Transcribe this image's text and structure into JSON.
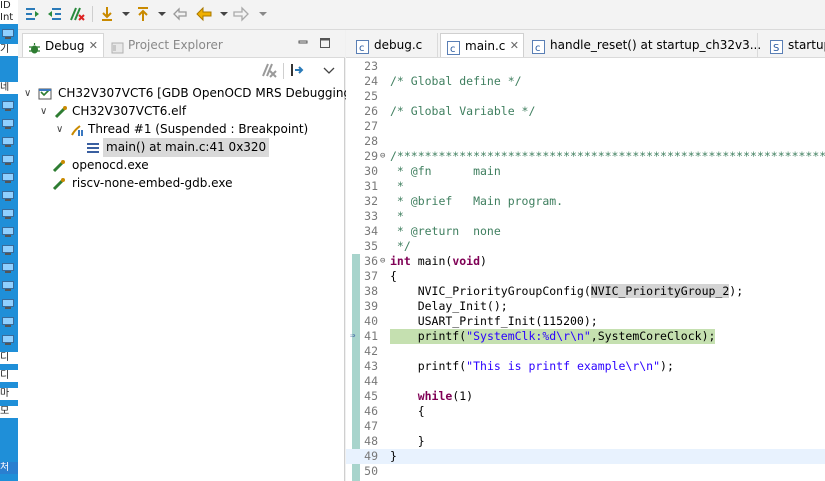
{
  "desktop": {
    "labels": [
      "ID",
      "Int",
      "기",
      "네",
      "디",
      "디",
      "마",
      "모",
      "처"
    ]
  },
  "left_panel": {
    "tabs": [
      {
        "label": "Debug",
        "close": "✕",
        "active": true
      },
      {
        "label": "Project Explorer",
        "active": false
      }
    ],
    "tree": [
      {
        "label": "CH32V307VCT6 [GDB OpenOCD MRS Debugging]",
        "level": 0,
        "arrow": "∨"
      },
      {
        "label": "CH32V307VCT6.elf",
        "level": 1,
        "arrow": "∨"
      },
      {
        "label": "Thread #1 (Suspended : Breakpoint)",
        "level": 2,
        "arrow": "∨"
      },
      {
        "label": "main() at main.c:41 0x320",
        "level": 3,
        "arrow": ""
      },
      {
        "label": "openocd.exe",
        "level": 1,
        "arrow": ""
      },
      {
        "label": "riscv-none-embed-gdb.exe",
        "level": 1,
        "arrow": ""
      }
    ]
  },
  "editor": {
    "tabs": [
      {
        "label": "debug.c",
        "active": false
      },
      {
        "label": "main.c",
        "close": "✕",
        "active": true
      },
      {
        "label": "handle_reset() at startup_ch32v3...",
        "active": false
      },
      {
        "label": "startup",
        "active": false
      }
    ],
    "lines": [
      {
        "n": "23",
        "t": ""
      },
      {
        "n": "24",
        "t": "/* Global define */"
      },
      {
        "n": "25",
        "t": ""
      },
      {
        "n": "26",
        "t": "/* Global Variable */"
      },
      {
        "n": "27",
        "t": ""
      },
      {
        "n": "28",
        "t": ""
      },
      {
        "n": "29",
        "t": "/*********************************************************************"
      },
      {
        "n": "30",
        "t": " * @fn      main"
      },
      {
        "n": "31",
        "t": " *"
      },
      {
        "n": "32",
        "t": " * @brief   Main program."
      },
      {
        "n": "33",
        "t": " *"
      },
      {
        "n": "34",
        "t": " * @return  none"
      },
      {
        "n": "35",
        "t": " */"
      },
      {
        "n": "36",
        "t": "int main(void)"
      },
      {
        "n": "37",
        "t": "{"
      },
      {
        "n": "38",
        "t": "    NVIC_PriorityGroupConfig(NVIC_PriorityGroup_2);"
      },
      {
        "n": "39",
        "t": "    Delay_Init();"
      },
      {
        "n": "40",
        "t": "    USART_Printf_Init(115200);"
      },
      {
        "n": "41",
        "t": "    printf(\"SystemClk:%d\\r\\n\",SystemCoreClock);"
      },
      {
        "n": "42",
        "t": ""
      },
      {
        "n": "43",
        "t": "    printf(\"This is printf example\\r\\n\");"
      },
      {
        "n": "44",
        "t": ""
      },
      {
        "n": "45",
        "t": "    while(1)"
      },
      {
        "n": "46",
        "t": "    {"
      },
      {
        "n": "47",
        "t": ""
      },
      {
        "n": "48",
        "t": "    }"
      },
      {
        "n": "49",
        "t": "}"
      },
      {
        "n": "50",
        "t": ""
      }
    ]
  },
  "colors": {
    "comment": "#3f7f5f",
    "keyword": "#7f0055",
    "string": "#2a00ff",
    "breakpoint_line": "#c5e0b0",
    "current_line": "#e8f2fe"
  }
}
